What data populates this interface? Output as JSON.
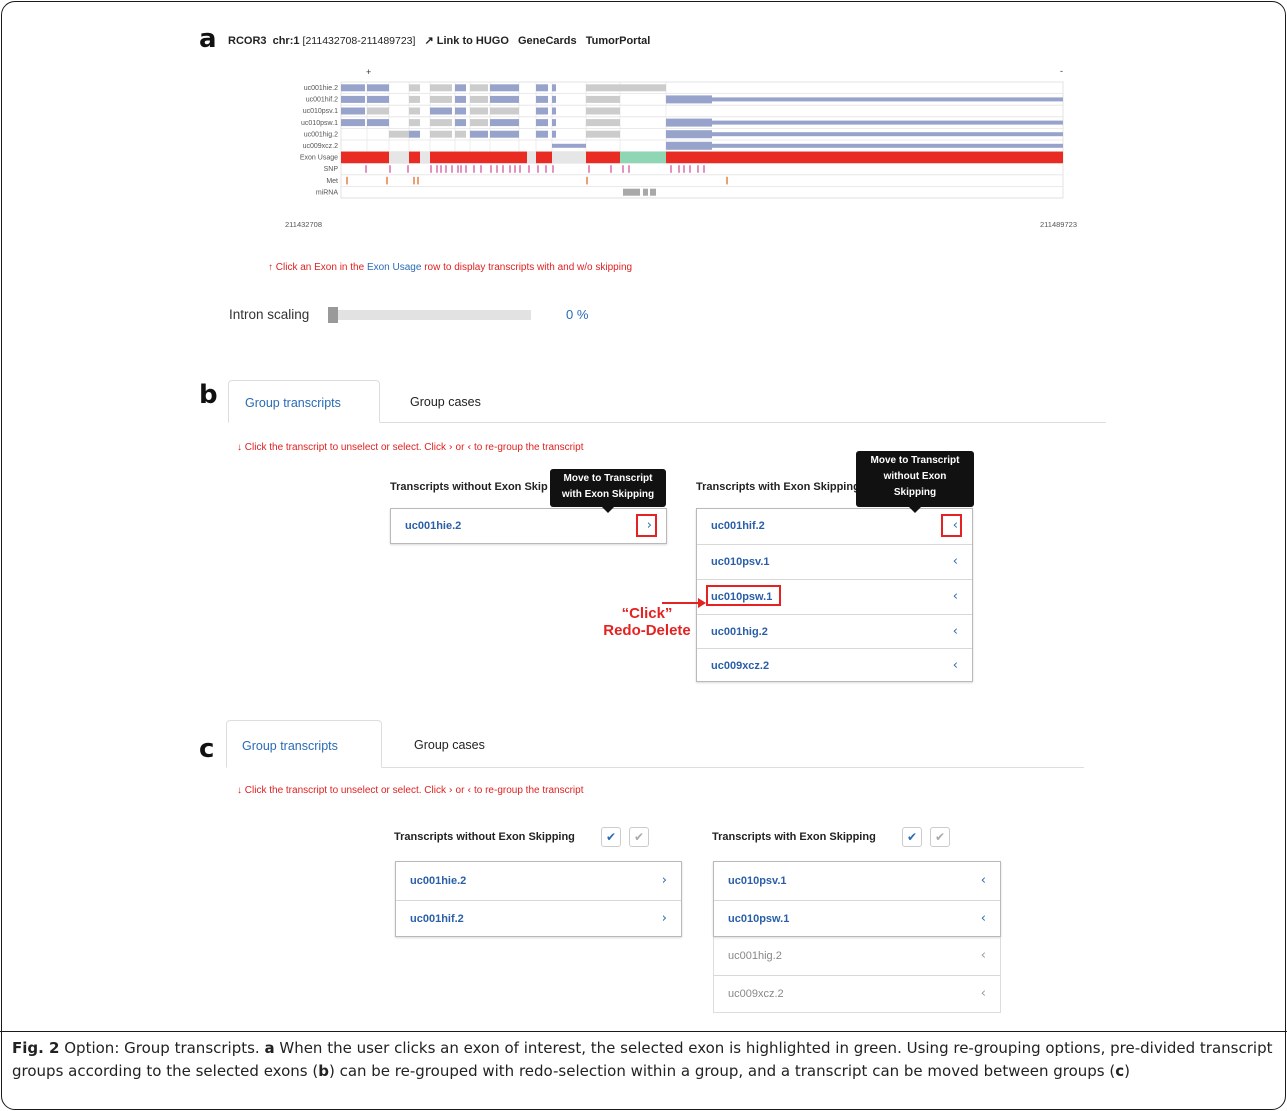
{
  "panel_a": {
    "letter": "a",
    "gene": "RCOR3",
    "chrom": "chr:1",
    "coords": "[211432708-211489723]",
    "link_hugo": "Link to HUGO",
    "link_genecards": "GeneCards",
    "link_tumorportal": "TumorPortal",
    "strand_plus": "+",
    "strand_minus": "-",
    "tracks": [
      "uc001hie.2",
      "uc001hif.2",
      "uc010psv.1",
      "uc010psw.1",
      "uc001hig.2",
      "uc009xcz.2",
      "Exon Usage",
      "SNP",
      "Met",
      "miRNA"
    ],
    "axis_start": "211432708",
    "axis_end": "211489723",
    "hint_prefix": "Click an Exon in the ",
    "hint_link": "Exon Usage",
    "hint_suffix": " row to display transcripts with and w/o skipping",
    "scale_label": "Intron scaling",
    "scale_value": "0 %",
    "scale_level": 0,
    "colors": {
      "transcript": "#98a3cc",
      "grey_exon": "#cccccc",
      "usage_red": "#e82c24",
      "usage_selected": "#8fd6b4",
      "snp": "#d24a9a",
      "met": "#e2763a",
      "mirna": "#a9a9a9"
    }
  },
  "panel_b": {
    "letter": "b",
    "tab_active": "Group transcripts",
    "tab_inactive": "Group cases",
    "hint": "Click the transcript to unselect or select. Click ",
    "hint_or": " or ",
    "hint_end": " to re-group the transcript",
    "left_head": "Transcripts without Exon Skip",
    "right_head": "Transcripts with Exon Skipping",
    "tooltip_left": [
      "Move to Transcript",
      "with Exon Skipping"
    ],
    "tooltip_right": [
      "Move to Transcript",
      "without Exon",
      "Skipping"
    ],
    "left_items": [
      "uc001hie.2"
    ],
    "right_items": [
      "uc001hif.2",
      "uc010psv.1",
      "uc010psw.1",
      "uc001hig.2",
      "uc009xcz.2"
    ],
    "click_note": [
      "“Click”",
      "Redo-Delete"
    ]
  },
  "panel_c": {
    "letter": "c",
    "tab_active": "Group transcripts",
    "tab_inactive": "Group cases",
    "hint": "Click the transcript to unselect or select. Click ",
    "hint_or": " or ",
    "hint_end": " to re-group the transcript",
    "left_head": "Transcripts without Exon Skipping",
    "right_head": "Transcripts with Exon Skipping",
    "left_items": [
      "uc001hie.2",
      "uc001hif.2"
    ],
    "right_items": [
      {
        "label": "uc010psv.1",
        "selected": true
      },
      {
        "label": "uc010psw.1",
        "selected": true
      },
      {
        "label": "uc001hig.2",
        "selected": false
      },
      {
        "label": "uc009xcz.2",
        "selected": false
      }
    ]
  },
  "caption": {
    "fig": "Fig. 2",
    "title": " Option: Group transcripts. ",
    "a": "a",
    "t1": " When the user clicks an exon of interest, the selected exon is highlighted in green. Using re-grouping options, pre-divided transcript groups according to the selected exons (",
    "b": "b",
    "t2": ") can be re-grouped with redo-selection within a group, and a transcript can be moved between groups (",
    "c": "c",
    "t3": ")"
  }
}
